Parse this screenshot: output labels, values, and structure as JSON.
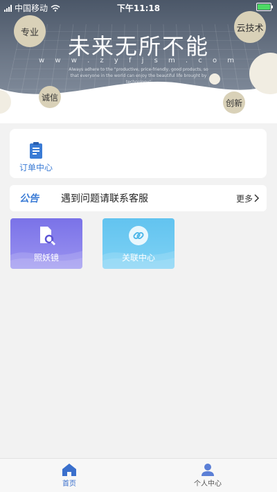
{
  "status_bar": {
    "carrier": "中国移动",
    "time": "下午11:18"
  },
  "hero": {
    "title": "未来无所不能",
    "url": "w w w . z y f j s m . c o m",
    "tagline": "Always adhere to the \"productive, price-friendly, good products, so that everyone in the world can enjoy the beautiful life brought by technology\"",
    "badges": {
      "professional": "专业",
      "cloud_tech": "云技术",
      "integrity": "诚信",
      "innovation": "创新"
    }
  },
  "order_card": {
    "label": "订单中心",
    "icon": "clipboard-icon"
  },
  "notice": {
    "tag": "公告",
    "text": "遇到问题请联系客服",
    "more": "更多"
  },
  "tiles": [
    {
      "label": "照妖镜",
      "icon": "document-search-icon",
      "color": "#7a72e8"
    },
    {
      "label": "关联中心",
      "icon": "link-icon",
      "color": "#62c3ef"
    }
  ],
  "bottom_nav": {
    "home": "首页",
    "profile": "个人中心"
  },
  "colors": {
    "accent": "#3a7bd5",
    "badge": "#d9d1b8"
  }
}
